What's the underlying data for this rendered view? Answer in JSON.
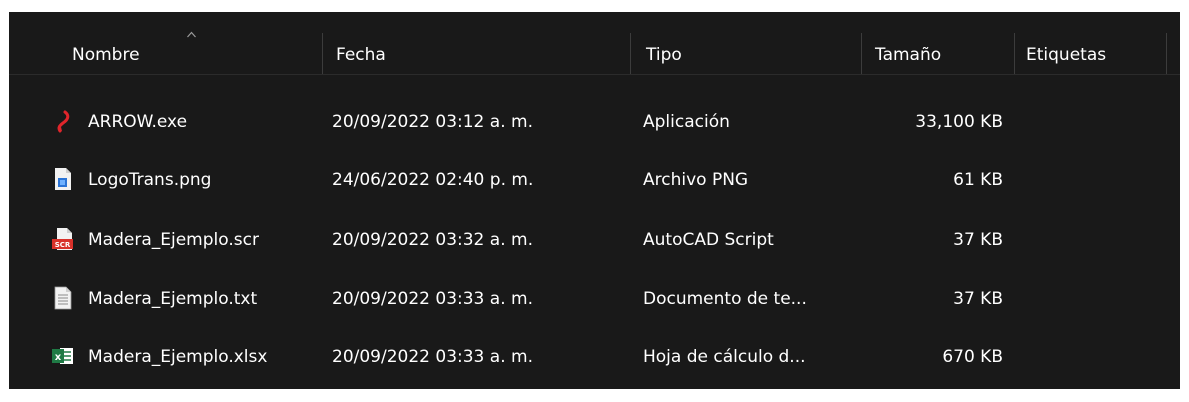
{
  "columns": {
    "name": "Nombre",
    "date": "Fecha",
    "type": "Tipo",
    "size": "Tamaño",
    "tags": "Etiquetas"
  },
  "sort": {
    "column": "name",
    "direction": "ascending",
    "icon": "sort-up-chevron-icon"
  },
  "files": [
    {
      "name": "ARROW.exe",
      "date": "20/09/2022 03:12 a. m.",
      "type": "Aplicación",
      "size": "33,100 KB",
      "icon": "arrow-app-icon"
    },
    {
      "name": "LogoTrans.png",
      "date": "24/06/2022 02:40 p. m.",
      "type": "Archivo PNG",
      "size": "61 KB",
      "icon": "png-file-icon"
    },
    {
      "name": "Madera_Ejemplo.scr",
      "date": "20/09/2022 03:32 a. m.",
      "type": "AutoCAD Script",
      "size": "37 KB",
      "icon": "scr-file-icon"
    },
    {
      "name": "Madera_Ejemplo.txt",
      "date": "20/09/2022 03:33 a. m.",
      "type": "Documento de te...",
      "size": "37 KB",
      "icon": "txt-file-icon"
    },
    {
      "name": "Madera_Ejemplo.xlsx",
      "date": "20/09/2022 03:33 a. m.",
      "type": "Hoja de cálculo d...",
      "size": "670 KB",
      "icon": "excel-file-icon"
    }
  ],
  "colors": {
    "background": "#191919",
    "text": "#ffffff",
    "separator": "#3c3c3c",
    "arrow_red": "#e0252b",
    "png_blue": "#2b74d6",
    "scr_red": "#d8312a",
    "excel_green": "#1f7a45"
  }
}
